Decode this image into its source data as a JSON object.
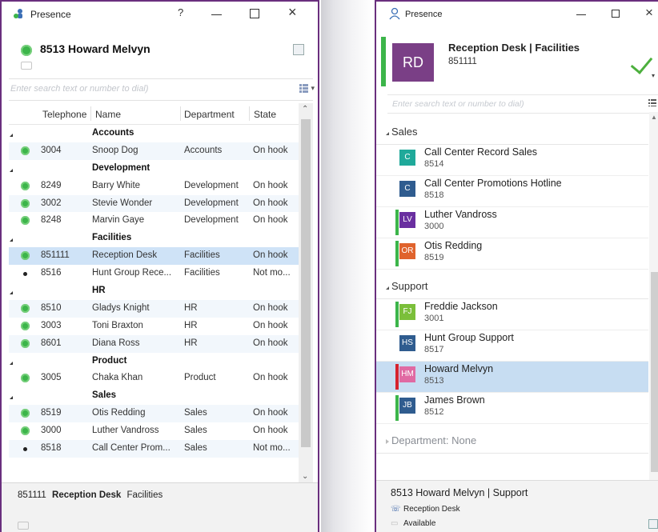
{
  "left": {
    "title": "Presence",
    "help": "?",
    "user": "8513 Howard Melvyn",
    "search_placeholder": "Enter search text or number to dial)",
    "columns": {
      "telephone": "Telephone",
      "name": "Name",
      "department": "Department",
      "state": "State"
    },
    "groups": [
      {
        "name": "Accounts",
        "rows": [
          {
            "status": "green",
            "tel": "3004",
            "name": "Snoop Dog",
            "dept": "Accounts",
            "state": "On hook"
          }
        ]
      },
      {
        "name": "Development",
        "rows": [
          {
            "status": "green",
            "tel": "8249",
            "name": "Barry White",
            "dept": "Development",
            "state": "On hook"
          },
          {
            "status": "green",
            "tel": "3002",
            "name": "Stevie Wonder",
            "dept": "Development",
            "state": "On hook"
          },
          {
            "status": "green",
            "tel": "8248",
            "name": "Marvin Gaye",
            "dept": "Development",
            "state": "On hook"
          }
        ]
      },
      {
        "name": "Facilities",
        "rows": [
          {
            "status": "green",
            "tel": "851111",
            "name": "Reception Desk",
            "dept": "Facilities",
            "state": "On hook",
            "selected": true
          },
          {
            "status": "bullet",
            "tel": "8516",
            "name": "Hunt Group Rece...",
            "dept": "Facilities",
            "state": "Not mo..."
          }
        ]
      },
      {
        "name": "HR",
        "rows": [
          {
            "status": "green",
            "tel": "8510",
            "name": "Gladys Knight",
            "dept": "HR",
            "state": "On hook"
          },
          {
            "status": "green",
            "tel": "3003",
            "name": "Toni Braxton",
            "dept": "HR",
            "state": "On hook"
          },
          {
            "status": "green",
            "tel": "8601",
            "name": "Diana Ross",
            "dept": "HR",
            "state": "On hook"
          }
        ]
      },
      {
        "name": "Product",
        "rows": [
          {
            "status": "green",
            "tel": "3005",
            "name": "Chaka Khan",
            "dept": "Product",
            "state": "On hook"
          }
        ]
      },
      {
        "name": "Sales",
        "rows": [
          {
            "status": "green",
            "tel": "8519",
            "name": "Otis Redding",
            "dept": "Sales",
            "state": "On hook"
          },
          {
            "status": "green",
            "tel": "3000",
            "name": "Luther Vandross",
            "dept": "Sales",
            "state": "On hook"
          },
          {
            "status": "bullet",
            "tel": "8518",
            "name": "Call Center Prom...",
            "dept": "Sales",
            "state": "Not mo..."
          }
        ]
      }
    ],
    "footer": {
      "number": "851111",
      "name": "Reception Desk",
      "dept": "Facilities"
    }
  },
  "right": {
    "title": "Presence",
    "user": {
      "initials": "RD",
      "name": "Reception Desk | Facilities",
      "number": "851111",
      "avatar_color": "#7a3f86"
    },
    "search_placeholder": "Enter search text or number to dial)",
    "groups": [
      {
        "name": "Sales",
        "items": [
          {
            "initials": "C",
            "name": "Call Center Record Sales",
            "ext": "8514",
            "avatar_color": "#1fa99a",
            "status_color": ""
          },
          {
            "initials": "C",
            "name": "Call Center Promotions Hotline",
            "ext": "8518",
            "avatar_color": "#2f5c8f",
            "status_color": ""
          },
          {
            "initials": "LV",
            "name": "Luther Vandross",
            "ext": "3000",
            "avatar_color": "#6a2fa0",
            "status_color": "#3cb54a"
          },
          {
            "initials": "OR",
            "name": "Otis Redding",
            "ext": "8519",
            "avatar_color": "#e0632d",
            "status_color": "#3cb54a"
          }
        ]
      },
      {
        "name": "Support",
        "items": [
          {
            "initials": "FJ",
            "name": "Freddie Jackson",
            "ext": "3001",
            "avatar_color": "#7bbf3a",
            "status_color": "#3cb54a"
          },
          {
            "initials": "HS",
            "name": "Hunt Group Support",
            "ext": "8517",
            "avatar_color": "#2f5c8f",
            "status_color": ""
          },
          {
            "initials": "HM",
            "name": "Howard Melvyn",
            "ext": "8513",
            "avatar_color": "#e06aa3",
            "status_color": "#d6232e",
            "selected": true
          },
          {
            "initials": "JB",
            "name": "James Brown",
            "ext": "8512",
            "avatar_color": "#2f5c8f",
            "status_color": "#3cb54a"
          }
        ]
      }
    ],
    "collapsed_group": "Department: None",
    "footer": {
      "line1": "8513  Howard Melvyn  |  Support",
      "line2": "Reception Desk",
      "line3": "Available"
    }
  }
}
